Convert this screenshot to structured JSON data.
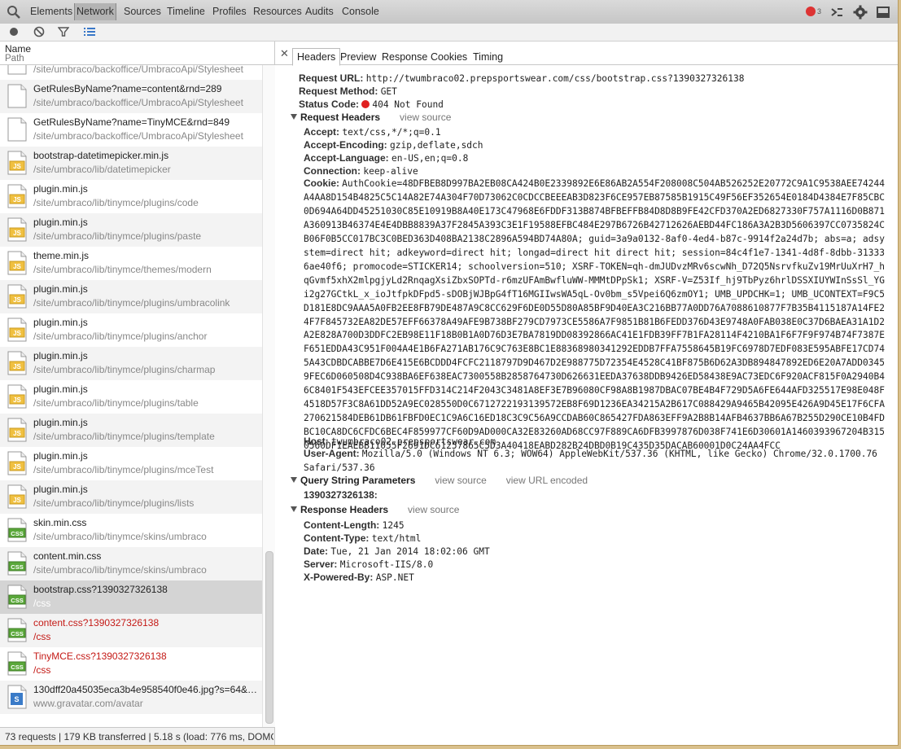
{
  "toolbar": {
    "tabs": [
      "Elements",
      "Network",
      "Sources",
      "Timeline",
      "Profiles",
      "Resources",
      "Audits",
      "Console"
    ],
    "active_tab": "Network",
    "error_count": "3"
  },
  "list_header": {
    "name": "Name",
    "path": "Path"
  },
  "requests": [
    {
      "name": "",
      "path": "/site/umbraco/backoffice/UmbracoApi/Stylesheet",
      "icon": "file-icon"
    },
    {
      "name": "GetRulesByName?name=content&rnd=289",
      "path": "/site/umbraco/backoffice/UmbracoApi/Stylesheet",
      "icon": "file-icon"
    },
    {
      "name": "GetRulesByName?name=TinyMCE&rnd=849",
      "path": "/site/umbraco/backoffice/UmbracoApi/Stylesheet",
      "icon": "file-icon"
    },
    {
      "name": "bootstrap-datetimepicker.min.js",
      "path": "/site/umbraco/lib/datetimepicker",
      "icon": "js-file-icon"
    },
    {
      "name": "plugin.min.js",
      "path": "/site/umbraco/lib/tinymce/plugins/code",
      "icon": "js-file-icon"
    },
    {
      "name": "plugin.min.js",
      "path": "/site/umbraco/lib/tinymce/plugins/paste",
      "icon": "js-file-icon"
    },
    {
      "name": "theme.min.js",
      "path": "/site/umbraco/lib/tinymce/themes/modern",
      "icon": "js-file-icon"
    },
    {
      "name": "plugin.min.js",
      "path": "/site/umbraco/lib/tinymce/plugins/umbracolink",
      "icon": "js-file-icon"
    },
    {
      "name": "plugin.min.js",
      "path": "/site/umbraco/lib/tinymce/plugins/anchor",
      "icon": "js-file-icon"
    },
    {
      "name": "plugin.min.js",
      "path": "/site/umbraco/lib/tinymce/plugins/charmap",
      "icon": "js-file-icon"
    },
    {
      "name": "plugin.min.js",
      "path": "/site/umbraco/lib/tinymce/plugins/table",
      "icon": "js-file-icon"
    },
    {
      "name": "plugin.min.js",
      "path": "/site/umbraco/lib/tinymce/plugins/template",
      "icon": "js-file-icon"
    },
    {
      "name": "plugin.min.js",
      "path": "/site/umbraco/lib/tinymce/plugins/mceTest",
      "icon": "js-file-icon"
    },
    {
      "name": "plugin.min.js",
      "path": "/site/umbraco/lib/tinymce/plugins/lists",
      "icon": "js-file-icon"
    },
    {
      "name": "skin.min.css",
      "path": "/site/umbraco/lib/tinymce/skins/umbraco",
      "icon": "css-file-icon"
    },
    {
      "name": "content.min.css",
      "path": "/site/umbraco/lib/tinymce/skins/umbraco",
      "icon": "css-file-icon"
    },
    {
      "name": "bootstrap.css?1390327326138",
      "path": "/css",
      "icon": "css-file-icon",
      "selected": true
    },
    {
      "name": "content.css?1390327326138",
      "path": "/css",
      "icon": "css-file-icon",
      "error": true
    },
    {
      "name": "TinyMCE.css?1390327326138",
      "path": "/css",
      "icon": "css-file-icon",
      "error": true
    },
    {
      "name": "130dff20a45035eca3b4e958540f0e46.jpg?s=64&d=…",
      "path": "www.gravatar.com/avatar",
      "icon": "image-file-icon"
    }
  ],
  "status_bar": "73 requests | 179 KB transferred | 5.18 s (load: 776 ms, DOMCo…",
  "detail_tabs": [
    "Headers",
    "Preview",
    "Response",
    "Cookies",
    "Timing"
  ],
  "active_detail_tab": "Headers",
  "general": {
    "request_url_key": "Request URL:",
    "request_url": "http://twumbraco02.prepsportswear.com/css/bootstrap.css?1390327326138",
    "request_method_key": "Request Method:",
    "request_method": "GET",
    "status_code_key": "Status Code:",
    "status_code": "404 Not Found"
  },
  "request_headers": {
    "title": "Request Headers",
    "view_source": "view source",
    "accept_key": "Accept:",
    "accept": "text/css,*/*;q=0.1",
    "encoding_key": "Accept-Encoding:",
    "encoding": "gzip,deflate,sdch",
    "language_key": "Accept-Language:",
    "language": "en-US,en;q=0.8",
    "connection_key": "Connection:",
    "connection": "keep-alive",
    "cookie_key": "Cookie:",
    "cookie": "AuthCookie=48DFBEB8D997BA2EB08CA424B0E2339892E6E86AB2A554F208008C504AB526252E20772C9A1C9538AEE74244A4AA8D154B4825C5C14A82E74A304F70D73062C0CDCCBEEEAB3D823F6CE957EB87585B1915C49F56EF352654E0184D4384E7F85CBC0D694A64DD45251030C85E10919B8A40E173C47968E6FDDF313B874BFBEFFB84D8D8B9FE42CFD370A2ED6827330F757A1116D0B871A360913B46374E4E4DBB8839A37F2845A393C3E1F19588EFBC484E297B6726B42712626AEBD44FC186A3A2B3D5606397CC0735824CB06F0B5CC017BC3C0BED363D408BA2138C2896A594BD74A80A; guid=3a9a0132-8af0-4ed4-b87c-9914f2a24d7b; abs=a; adsystem=direct hit; adkeyword=direct hit; longad=direct hit direct hit; session=84c4f1e7-1341-4d8f-8dbb-313336ae40f6; promocode=STICKER14; schoolversion=510; XSRF-TOKEN=qh-dmJUDvzMRv6scwNh_D72Q5NsrvfkuZv19MrUuXrH7_hqGvmf5xhX2mlpgjyLd2RnqagXsiZbxSOPTd-r6mzUFAmBwfluWW-MMMtDPpSk1; XSRF-V=Z53If_hj9TbPyz6hrlDSSXIUYWInSsSl_YGi2g27GCtkL_x_ioJtfpkDFpd5-sDOBjWJBpG4fT16MGIIwsWA5qL-Ov0bm_s5Vpei6Q6zmOY1; UMB_UPDCHK=1; UMB_UCONTEXT=F9C5D181E8DC9AAA5A0FB2EE8FB79DE487A9C8CC629F6DE0D55D80A85BF9D40EA3C216BB77A0DD76A7088610877F7B35B4115187A14FE24F7F845732EA82DE57EFF66378A49AFE9B738BF279CD7973CE5586A7F9851B81B6FEDD376D43E9748A0FAB038E0C37D6BAEA31A1D2A2E828A700D3DDFC2EB98E11F18B0B1A0D76D3E7BA7819DD08392866AC41E1FDB39FF7B1FA28114F4210BA1F6F7F9F974B74F7387EF651EDDA43C951F004A4E1B6FA271AB176C9C763E8BC1E88368980341292EDDB7FFA7558645B19FC6978D7EDF083E595ABFE17CD745A43CDBDCABBE7D6E415E6BCDDD4FCFC2118797D9D467D2E988775D72354E4528C41BF875B6D62A3DB894847892ED6E20A7ADD03459FEC6D060508D4C938BA6EF638EAC7300558B2858764730D626631EEDA37638DDB9426ED58438E9AC73EDC6F920ACF815F0A2940B46C8401F543EFCEE357015FFD314C214F2043C3481A8EF3E7B96080CF98A8B1987DBAC07BE4B4F729D5A6FE644AFD325517E98E048F4518D57F3C8A61DD52A9EC028550D0C6712722193139572EB8F69D1236EA34215A2B617C088429A9465B42095E426A9D45E17F6CFA270621584DEB61DB61FBFD0EC1C9A6C16ED18C3C9C56A9CCDAB60C865427FDA863EFF9A2B8B14AFB4637BB6A67B255D290CE10B4FDBC10CA8DC6CFDC6BEC4F859977CF60D9AD000CA32E83260AD68CC97F889CA6DFB3997876D038F741E6D30601A1460393967204B3150560DF1EAEBB11055F2691DC61257865C5D3A40418EABD282B24DBD0B19C435D35DACAB60001D0C24AA4FCC",
    "host_key": "Host:",
    "host": "twumbraco02.prepsportswear.com",
    "ua_key": "User-Agent:",
    "ua": "Mozilla/5.0 (Windows NT 6.3; WOW64) AppleWebKit/537.36 (KHTML, like Gecko) Chrome/32.0.1700.76 Safari/537.36"
  },
  "query_string": {
    "title": "Query String Parameters",
    "view_source": "view source",
    "view_url_encoded": "view URL encoded",
    "param": "1390327326138:"
  },
  "response_headers": {
    "title": "Response Headers",
    "view_source": "view source",
    "cl_key": "Content-Length:",
    "cl": "1245",
    "ct_key": "Content-Type:",
    "ct": "text/html",
    "date_key": "Date:",
    "date": "Tue, 21 Jan 2014 18:02:06 GMT",
    "server_key": "Server:",
    "server": "Microsoft-IIS/8.0",
    "xpb_key": "X-Powered-By:",
    "xpb": "ASP.NET"
  }
}
